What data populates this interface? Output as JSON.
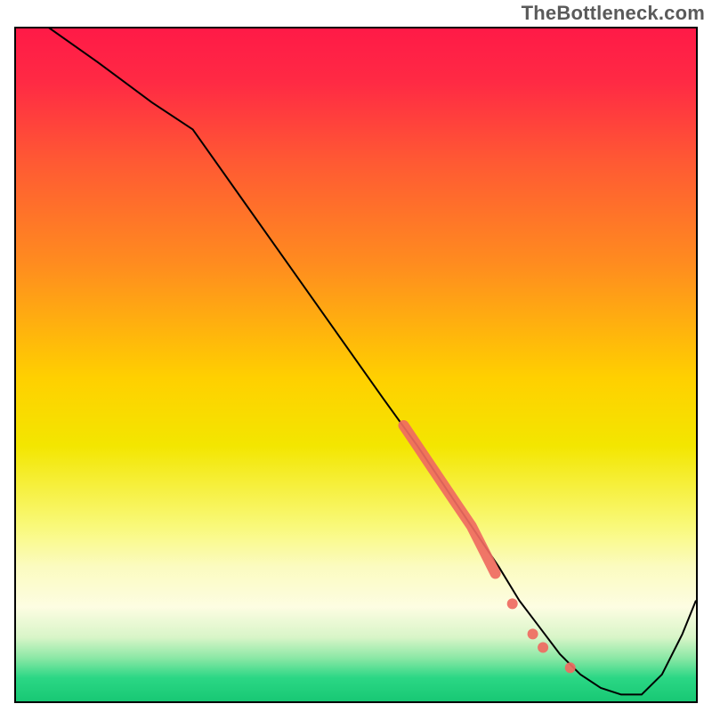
{
  "watermark": "TheBottleneck.com",
  "chart_data": {
    "type": "line",
    "title": "",
    "xlabel": "",
    "ylabel": "",
    "xlim": [
      0,
      100
    ],
    "ylim": [
      0,
      100
    ],
    "gradient_stops": [
      {
        "offset": 0.0,
        "color": "#ff1a47"
      },
      {
        "offset": 0.08,
        "color": "#ff2a44"
      },
      {
        "offset": 0.2,
        "color": "#ff5a33"
      },
      {
        "offset": 0.35,
        "color": "#ff8c1f"
      },
      {
        "offset": 0.52,
        "color": "#ffd000"
      },
      {
        "offset": 0.62,
        "color": "#f3e600"
      },
      {
        "offset": 0.74,
        "color": "#f9f97a"
      },
      {
        "offset": 0.8,
        "color": "#fbfbc0"
      },
      {
        "offset": 0.86,
        "color": "#fdfde2"
      },
      {
        "offset": 0.905,
        "color": "#d8f5c8"
      },
      {
        "offset": 0.935,
        "color": "#8de8a6"
      },
      {
        "offset": 0.965,
        "color": "#2bd785"
      },
      {
        "offset": 1.0,
        "color": "#18c874"
      }
    ],
    "series": [
      {
        "name": "bottleneck-curve",
        "color": "#000000",
        "width": 2,
        "x": [
          0,
          5,
          12,
          20,
          26,
          33,
          40,
          47,
          54,
          59,
          63,
          67,
          71,
          74,
          77,
          80,
          83,
          86,
          89,
          92,
          95,
          98,
          100
        ],
        "values": [
          103,
          100,
          95,
          89,
          85,
          75,
          65,
          55,
          45,
          38,
          32,
          26,
          20,
          15,
          11,
          7,
          4,
          2,
          1,
          1,
          4,
          10,
          15
        ]
      }
    ],
    "highlight_segment": {
      "color": "#ef6a61",
      "width": 12,
      "cap": "round",
      "x": [
        57,
        59,
        61,
        63,
        65,
        67,
        69,
        70.5
      ],
      "values": [
        41,
        38,
        35,
        32,
        29,
        26,
        22,
        19
      ]
    },
    "highlight_points": {
      "color": "#ef6a61",
      "radius": 6,
      "points": [
        {
          "x": 73.0,
          "y": 14.5
        },
        {
          "x": 76.0,
          "y": 10.0
        },
        {
          "x": 77.5,
          "y": 8.0
        },
        {
          "x": 81.5,
          "y": 5.0
        }
      ]
    }
  }
}
